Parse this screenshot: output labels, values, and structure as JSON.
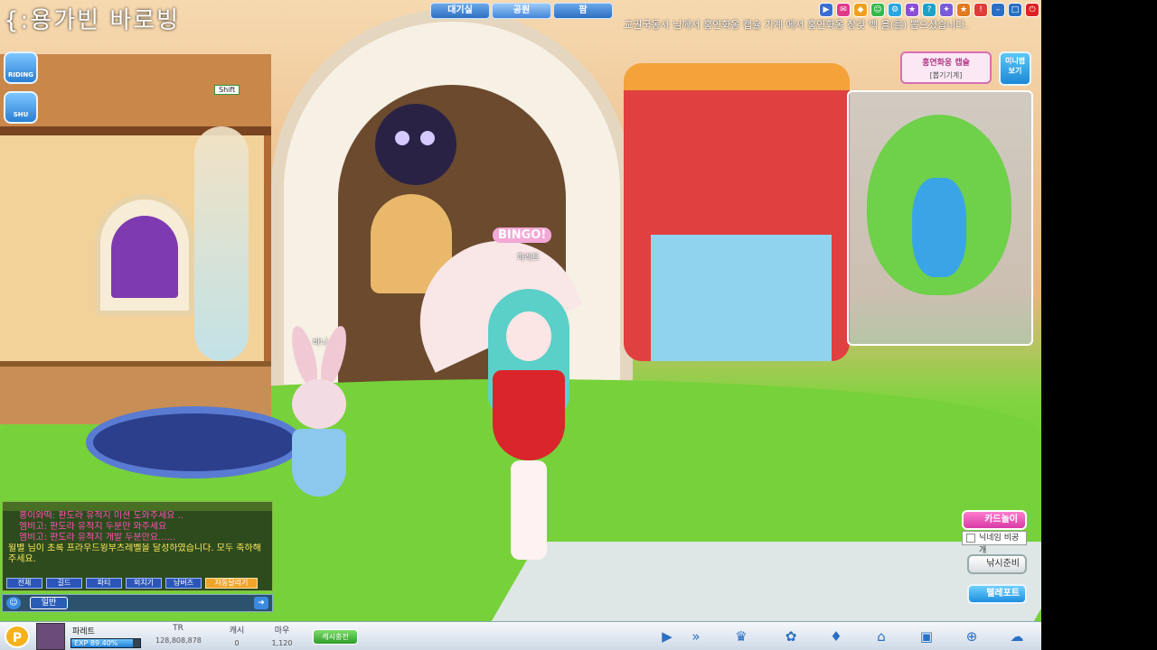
{
  "window_title": "{:용가빈 바로빙",
  "top_tabs": [
    "대기실",
    "공원",
    "팜"
  ],
  "notice": "교권국동사 님께서 홍연화옹 캡슐 기계 에서 홍연화옹 장갖 백 을(를) 뽑으셨습니다.",
  "side_buttons": [
    "RIDING",
    "SHU"
  ],
  "shift_label": "Shift",
  "bingo_label": "BINGO!",
  "name_tags": {
    "umbrella_girl": "파레트",
    "bunny": "바니"
  },
  "minimap": {
    "title": "홍연화옹 캡슐",
    "subtitle": "[뽑기기계]",
    "view_button": "미니맵 보기"
  },
  "right_buttons": {
    "card": "카드놀이",
    "nickname": "닉네임 비공개",
    "fishing": "낚시준비",
    "teleport": "텔레포트"
  },
  "chat": {
    "lines": [
      {
        "color": "pink",
        "text": "홍이와떡: 판도라 유적지 미션 도와주세요 .."
      },
      {
        "color": "pink",
        "text": "엠비고: 판도라 유적지 두분만 와주세요"
      },
      {
        "color": "pink",
        "text": "엠비고: 판도라 유적지 개발 두분만요......"
      },
      {
        "color": "yellow",
        "text": "윌별 님이 초록 프라우드윙부츠레벨을 달성하였습니다. 모두 축하해 주세요."
      }
    ],
    "tabs": [
      "전체",
      "길드",
      "파티",
      "외치기",
      "냠버즈",
      "자동달리기"
    ],
    "mode": "일반"
  },
  "status": {
    "p_badge": "P",
    "username": "파레트",
    "exp_label": "EXP 89.40%",
    "exp_percent": 89.4,
    "stats": [
      {
        "label": "TR",
        "value": "128,808,878"
      },
      {
        "label": "캐시",
        "value": "0"
      },
      {
        "label": "마우",
        "value": "1,120"
      }
    ],
    "cash_button": "캐시충전"
  },
  "dock_icons": [
    "play-icon",
    "fast-forward-icon",
    "trophy-icon",
    "paw-icon",
    "handshake-icon",
    "shop-icon",
    "bag-icon",
    "cart-icon",
    "chat-icon"
  ]
}
